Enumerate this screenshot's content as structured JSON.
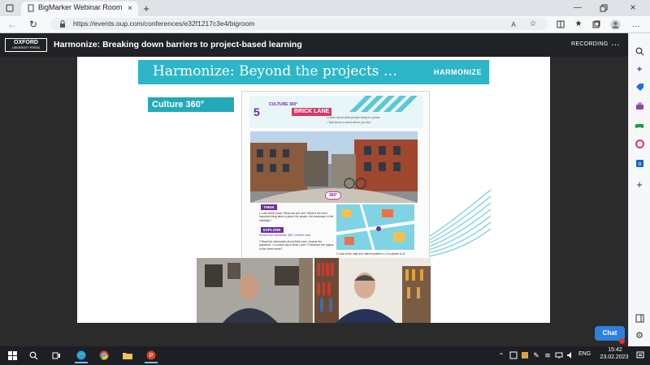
{
  "browser": {
    "tab_title": "BigMarker Webinar Room",
    "url": "https://events.oup.com/conferences/e32f1217c3e4/bigroom"
  },
  "webinar": {
    "logo_line1": "OXFORD",
    "logo_line2": "UNIVERSITY PRESS",
    "title": "Harmonize: Breaking down barriers to project-based learning",
    "recording_label": "RECORDING",
    "more_label": "…"
  },
  "slide": {
    "title": "Harmonize: Beyond the projects …",
    "brand": "HARMONIZE",
    "culture_label": "Culture 360°"
  },
  "book": {
    "unit_number": "5",
    "culture_tag": "CULTURE 360°",
    "lesson_title": "BRICK LANE",
    "objective_1": "• Learn about what people bring to a place",
    "objective_2": "• Talk about a street where you live",
    "badge_360": "360°",
    "think_label": "THINK",
    "think_text": "1 Look at the photo. What can you see? What is the most important thing about a place: the people, the landscape or the buildings?",
    "explore_label": "EXPLORE",
    "review_text": "Review the interactive 360° content now!",
    "read_text": "2 Read the information about Brick Lane. Answer the questions. 1 In which city is Brick Lane? 2 What are the origins of the street name?",
    "match_text": "3 Look at the map and match locations 1–4 to places A–D."
  },
  "chat": {
    "label": "Chat"
  },
  "taskbar": {
    "lang": "ENG",
    "time": "15:42",
    "date": "23.02.2023"
  },
  "colors": {
    "teal": "#2cb6c8",
    "purple": "#6b2fa0",
    "pink": "#d63a6b",
    "chat_blue": "#2f7fe0"
  }
}
